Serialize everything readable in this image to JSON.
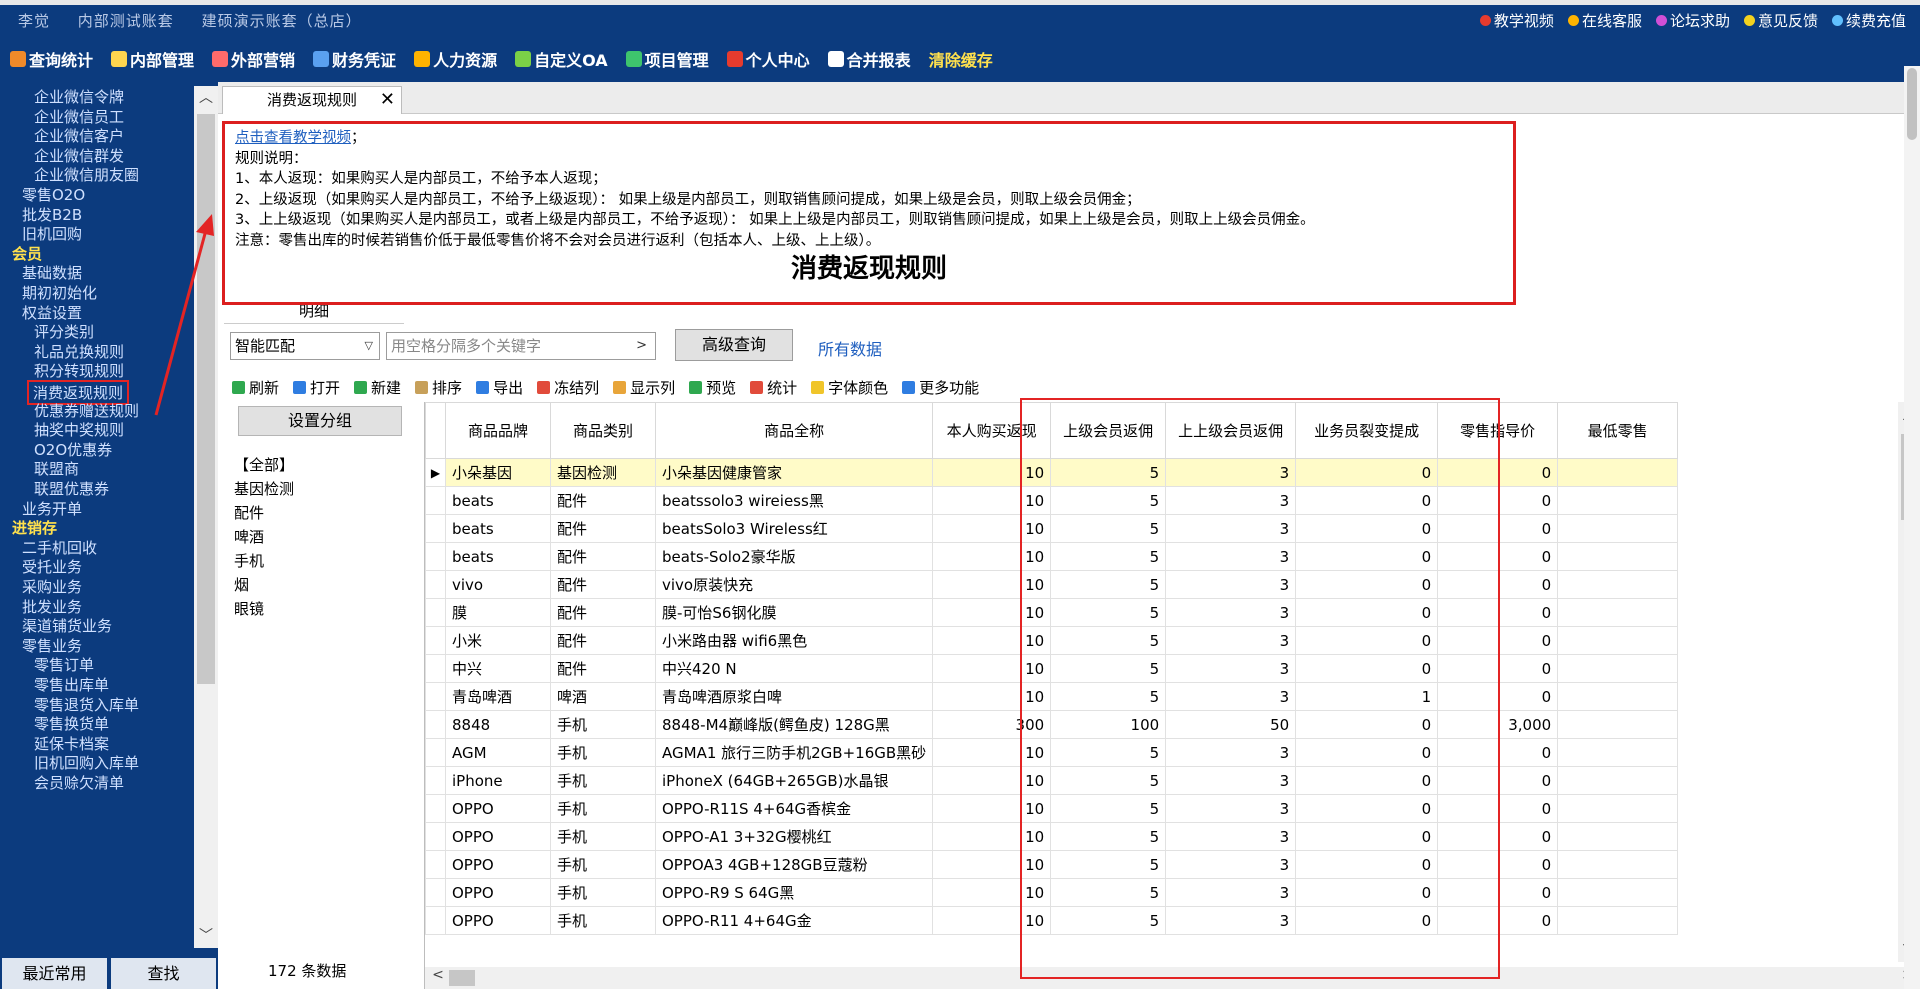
{
  "account": {
    "user": "李觉",
    "ledger": "内部测试账套",
    "demo": "建硕演示账套（总店）"
  },
  "top_links": [
    {
      "label": "教学视频",
      "color": "#e63b2e"
    },
    {
      "label": "在线客服",
      "color": "#ffb400"
    },
    {
      "label": "论坛求助",
      "color": "#d14fd6"
    },
    {
      "label": "意见反馈",
      "color": "#f4d21f"
    },
    {
      "label": "续费充值",
      "color": "#61c0ff"
    }
  ],
  "menu": [
    {
      "label": "查询统计",
      "color": "#f08a2a"
    },
    {
      "label": "内部管理",
      "color": "#ffd54f"
    },
    {
      "label": "外部营销",
      "color": "#ff6b6b"
    },
    {
      "label": "财务凭证",
      "color": "#5aa0f0"
    },
    {
      "label": "人力资源",
      "color": "#ffb300"
    },
    {
      "label": "自定义OA",
      "color": "#7bd147"
    },
    {
      "label": "项目管理",
      "color": "#3ec46d"
    },
    {
      "label": "个人中心",
      "color": "#e63b2e"
    },
    {
      "label": "合并报表",
      "color": "#ffffff"
    },
    {
      "label": "清除缓存",
      "color": "none"
    }
  ],
  "sidebar": {
    "items": [
      {
        "label": "企业微信令牌",
        "level": "l3"
      },
      {
        "label": "企业微信员工",
        "level": "l3"
      },
      {
        "label": "企业微信客户",
        "level": "l3"
      },
      {
        "label": "企业微信群发",
        "level": "l3"
      },
      {
        "label": "企业微信朋友圈",
        "level": "l3"
      },
      {
        "label": "零售O2O",
        "level": "l2"
      },
      {
        "label": "批发B2B",
        "level": "l2"
      },
      {
        "label": "旧机回购",
        "level": "l2"
      },
      {
        "label": "会员",
        "level": "l1"
      },
      {
        "label": "基础数据",
        "level": "l2"
      },
      {
        "label": "期初初始化",
        "level": "l2"
      },
      {
        "label": "权益设置",
        "level": "l2"
      },
      {
        "label": "评分类别",
        "level": "l3"
      },
      {
        "label": "礼品兑换规则",
        "level": "l3"
      },
      {
        "label": "积分转现规则",
        "level": "l3"
      },
      {
        "label": "消费返现规则",
        "level": "l3",
        "active": true
      },
      {
        "label": "优惠券赠送规则",
        "level": "l3"
      },
      {
        "label": "抽奖中奖规则",
        "level": "l3"
      },
      {
        "label": "O2O优惠券",
        "level": "l3"
      },
      {
        "label": "联盟商",
        "level": "l3"
      },
      {
        "label": "联盟优惠券",
        "level": "l3"
      },
      {
        "label": "业务开单",
        "level": "l2"
      },
      {
        "label": "进销存",
        "level": "l1"
      },
      {
        "label": "二手机回收",
        "level": "l2"
      },
      {
        "label": "受托业务",
        "level": "l2"
      },
      {
        "label": "采购业务",
        "level": "l2"
      },
      {
        "label": "批发业务",
        "level": "l2"
      },
      {
        "label": "渠道铺货业务",
        "level": "l2"
      },
      {
        "label": "零售业务",
        "level": "l2"
      },
      {
        "label": "零售订单",
        "level": "l3"
      },
      {
        "label": "零售出库单",
        "level": "l3"
      },
      {
        "label": "零售退货入库单",
        "level": "l3"
      },
      {
        "label": "零售换货单",
        "level": "l3"
      },
      {
        "label": "延保卡档案",
        "level": "l3"
      },
      {
        "label": "旧机回购入库单",
        "level": "l3"
      },
      {
        "label": "会员赊欠清单",
        "level": "l3"
      }
    ],
    "bottom_tabs": [
      "最近常用",
      "查找"
    ]
  },
  "tab": {
    "title": "消费返现规则",
    "close": "✕"
  },
  "rules": {
    "video_link": "点击查看教学视频",
    "video_suffix": "；",
    "lines": [
      "规则说明：",
      "1、本人返现：如果购买人是内部员工，不给予本人返现；",
      "2、上级返现（如果购买人是内部员工，不给予上级返现）： 如果上级是内部员工，则取销售顾问提成，如果上级是会员，则取上级会员佣金；",
      "3、上上级返现（如果购买人是内部员工，或者上级是内部员工，不给予返现）： 如果上上级是内部员工，则取销售顾问提成，如果上上级是会员，则取上上级会员佣金。",
      "注意：零售出库的时候若销售价低于最低零售价将不会对会员进行返利（包括本人、上级、上上级）。"
    ],
    "title": "消费返现规则"
  },
  "detail_tab": "明细",
  "search": {
    "mode": "智能匹配",
    "placeholder": "用空格分隔多个关键字",
    "advanced": "高级查询",
    "all_data": "所有数据"
  },
  "toolbar": [
    {
      "label": "刷新",
      "color": "#2fa84f"
    },
    {
      "label": "打开",
      "color": "#2f7de1"
    },
    {
      "label": "新建",
      "color": "#2fa84f"
    },
    {
      "label": "排序",
      "color": "#c7a05a"
    },
    {
      "label": "导出",
      "color": "#2f7de1"
    },
    {
      "label": "冻结列",
      "color": "#e14b3b"
    },
    {
      "label": "显示列",
      "color": "#e8a53a"
    },
    {
      "label": "预览",
      "color": "#2fa84f"
    },
    {
      "label": "统计",
      "color": "#e14b3b"
    },
    {
      "label": "字体颜色",
      "color": "#f0c52a"
    },
    {
      "label": "更多功能",
      "color": "#2f7de1"
    }
  ],
  "groups": {
    "button": "设置分组",
    "items": [
      "【全部】",
      "基因检测",
      "配件",
      "啤酒",
      "手机",
      "烟",
      "眼镜"
    ],
    "count": "172 条数据"
  },
  "table": {
    "columns": [
      "商品品牌",
      "商品类别",
      "商品全称",
      "本人购买返现",
      "上级会员返佣",
      "上上级会员返佣",
      "业务员裂变提成",
      "零售指导价",
      "最低零售"
    ],
    "rows": [
      [
        "小朵基因",
        "基因检测",
        "小朵基因健康管家",
        "10",
        "5",
        "3",
        "0",
        "0",
        ""
      ],
      [
        "beats",
        "配件",
        "beatssolo3 wireiess黑",
        "10",
        "5",
        "3",
        "0",
        "0",
        ""
      ],
      [
        "beats",
        "配件",
        "beatsSolo3 Wireless红",
        "10",
        "5",
        "3",
        "0",
        "0",
        ""
      ],
      [
        "beats",
        "配件",
        "beats-Solo2豪华版",
        "10",
        "5",
        "3",
        "0",
        "0",
        ""
      ],
      [
        "vivo",
        "配件",
        "vivo原装快充",
        "10",
        "5",
        "3",
        "0",
        "0",
        ""
      ],
      [
        "膜",
        "配件",
        "膜-可怡S6钢化膜",
        "10",
        "5",
        "3",
        "0",
        "0",
        ""
      ],
      [
        "小米",
        "配件",
        "小米路由器 wifi6黑色",
        "10",
        "5",
        "3",
        "0",
        "0",
        ""
      ],
      [
        "中兴",
        "配件",
        "中兴420 N",
        "10",
        "5",
        "3",
        "0",
        "0",
        ""
      ],
      [
        "青岛啤酒",
        "啤酒",
        "青岛啤酒原浆白啤",
        "10",
        "5",
        "3",
        "1",
        "0",
        ""
      ],
      [
        "8848",
        "手机",
        "8848-M4巅峰版(鳄鱼皮) 128G黑",
        "300",
        "100",
        "50",
        "0",
        "3,000",
        ""
      ],
      [
        "AGM",
        "手机",
        "AGMA1 旅行三防手机2GB+16GB黑砂",
        "10",
        "5",
        "3",
        "0",
        "0",
        ""
      ],
      [
        "iPhone",
        "手机",
        "iPhoneX (64GB+265GB)水晶银",
        "10",
        "5",
        "3",
        "0",
        "0",
        ""
      ],
      [
        "OPPO",
        "手机",
        "OPPO-R11S 4+64G香槟金",
        "10",
        "5",
        "3",
        "0",
        "0",
        ""
      ],
      [
        "OPPO",
        "手机",
        "OPPO-A1 3+32G樱桃红",
        "10",
        "5",
        "3",
        "0",
        "0",
        ""
      ],
      [
        "OPPO",
        "手机",
        "OPPOA3 4GB+128GB豆蔻粉",
        "10",
        "5",
        "3",
        "0",
        "0",
        ""
      ],
      [
        "OPPO",
        "手机",
        "OPPO-R9 S 64G黑",
        "10",
        "5",
        "3",
        "0",
        "0",
        ""
      ],
      [
        "OPPO",
        "手机",
        "OPPO-R11 4+64G金",
        "10",
        "5",
        "3",
        "0",
        "0",
        ""
      ]
    ]
  }
}
